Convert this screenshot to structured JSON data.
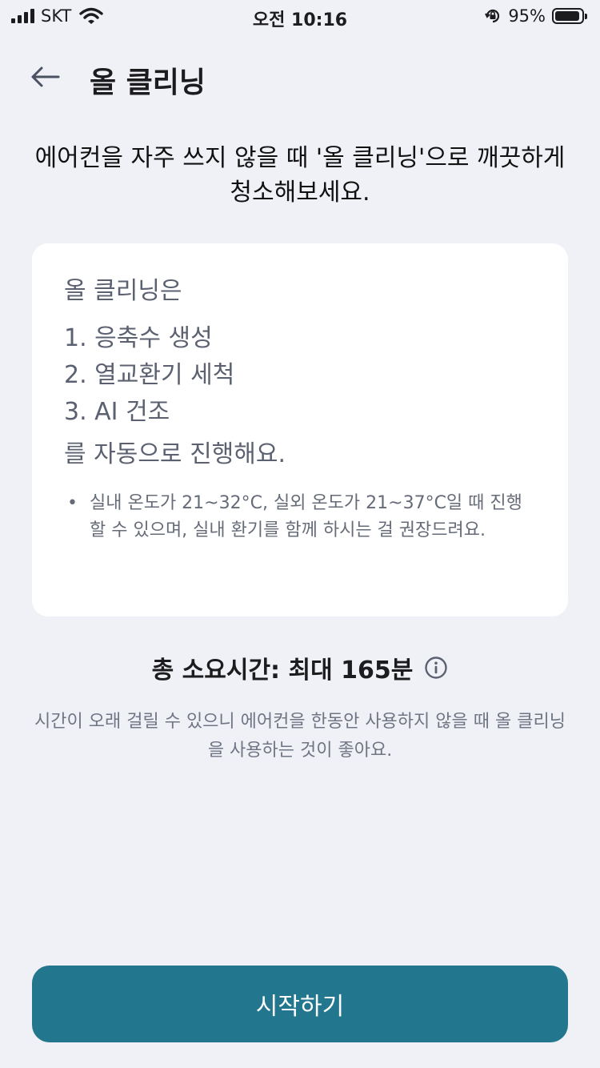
{
  "status_bar": {
    "carrier": "SKT",
    "time": "오전 10:16",
    "battery_percent": "95%",
    "battery_level": 0.95
  },
  "header": {
    "back_icon": "back-arrow-icon",
    "title": "올 클리닝"
  },
  "intro": {
    "text": "에어컨을 자주 쓰지 않을 때 '올 클리닝'으로 깨끗하게 청소해보세요."
  },
  "card": {
    "lead": "올 클리닝은",
    "steps": [
      "1. 응축수 생성",
      "2. 열교환기 세척",
      "3. AI 건조"
    ],
    "tail": "를 자동으로 진행해요.",
    "note_bullet": "•",
    "note": "실내 온도가 21~32°C, 실외 온도가 21~37°C일 때 진행할 수 있으며, 실내 환기를 함께 하시는 걸 권장드려요."
  },
  "duration": {
    "text": "총 소요시간: 최대 165분",
    "info_icon": "info-icon"
  },
  "description": "시간이 오래 걸릴 수 있으니 에어컨을 한동안 사용하지 않을 때 올 클리닝을 사용하는 것이 좋아요.",
  "start_button": {
    "label": "시작하기",
    "color": "#22768d"
  }
}
